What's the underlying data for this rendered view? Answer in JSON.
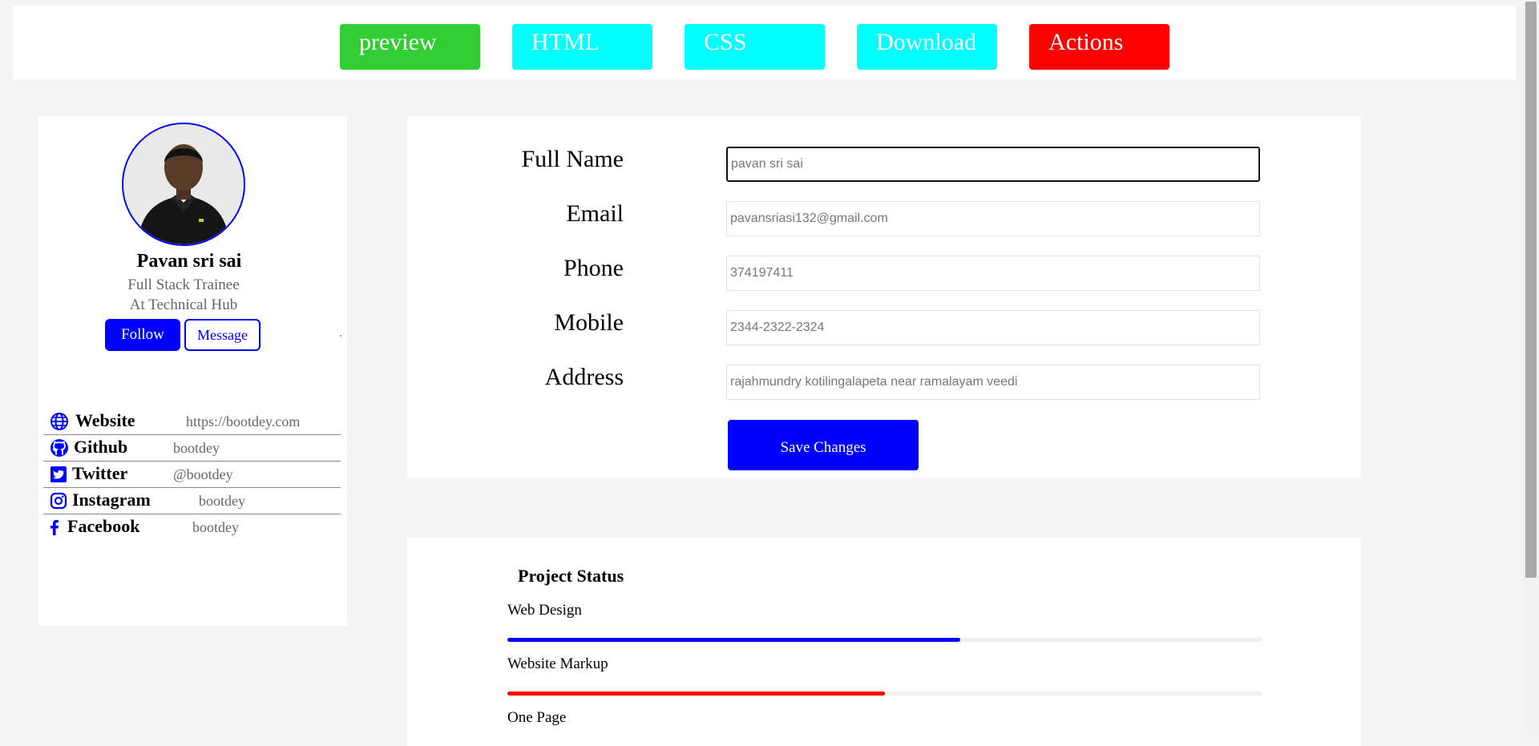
{
  "toolbar": {
    "buttons": [
      {
        "label": "preview",
        "color": "#32cd32"
      },
      {
        "label": "HTML",
        "color": "#00ffff"
      },
      {
        "label": "CSS",
        "color": "#00ffff"
      },
      {
        "label": "Download",
        "color": "#00ffff"
      },
      {
        "label": "Actions",
        "color": "#ff0000"
      }
    ]
  },
  "profile": {
    "name": "Pavan sri sai",
    "role_line1": "Full Stack Trainee",
    "role_line2": "At Technical Hub",
    "follow_label": "Follow",
    "message_label": "Message",
    "social": [
      {
        "icon": "globe-icon",
        "label": "Website",
        "value": "https://bootdey.com"
      },
      {
        "icon": "github-icon",
        "label": "Github",
        "value": "bootdey"
      },
      {
        "icon": "twitter-icon",
        "label": "Twitter",
        "value": "@bootdey"
      },
      {
        "icon": "instagram-icon",
        "label": "Instagram",
        "value": "bootdey"
      },
      {
        "icon": "facebook-icon",
        "label": "Facebook",
        "value": "bootdey"
      }
    ]
  },
  "form": {
    "fields": [
      {
        "label": "Full Name",
        "value": "pavan sri sai"
      },
      {
        "label": "Email",
        "value": "pavansriasi132@gmail.com"
      },
      {
        "label": "Phone",
        "value": "374197411"
      },
      {
        "label": "Mobile",
        "value": "2344-2322-2324"
      },
      {
        "label": "Address",
        "value": "rajahmundry kotilingalapeta near ramalayam veedi"
      }
    ],
    "save_label": "Save Changes"
  },
  "project_status": {
    "title": "Project Status",
    "projects": [
      {
        "label": "Web Design",
        "progress": 0.6,
        "color": "#0000ff"
      },
      {
        "label": "Website Markup",
        "progress": 0.5,
        "color": "#ff0000"
      },
      {
        "label": "One Page"
      }
    ]
  },
  "colors": {
    "accent": "#0000ff",
    "background": "#f4f4f4",
    "card": "#ffffff"
  }
}
